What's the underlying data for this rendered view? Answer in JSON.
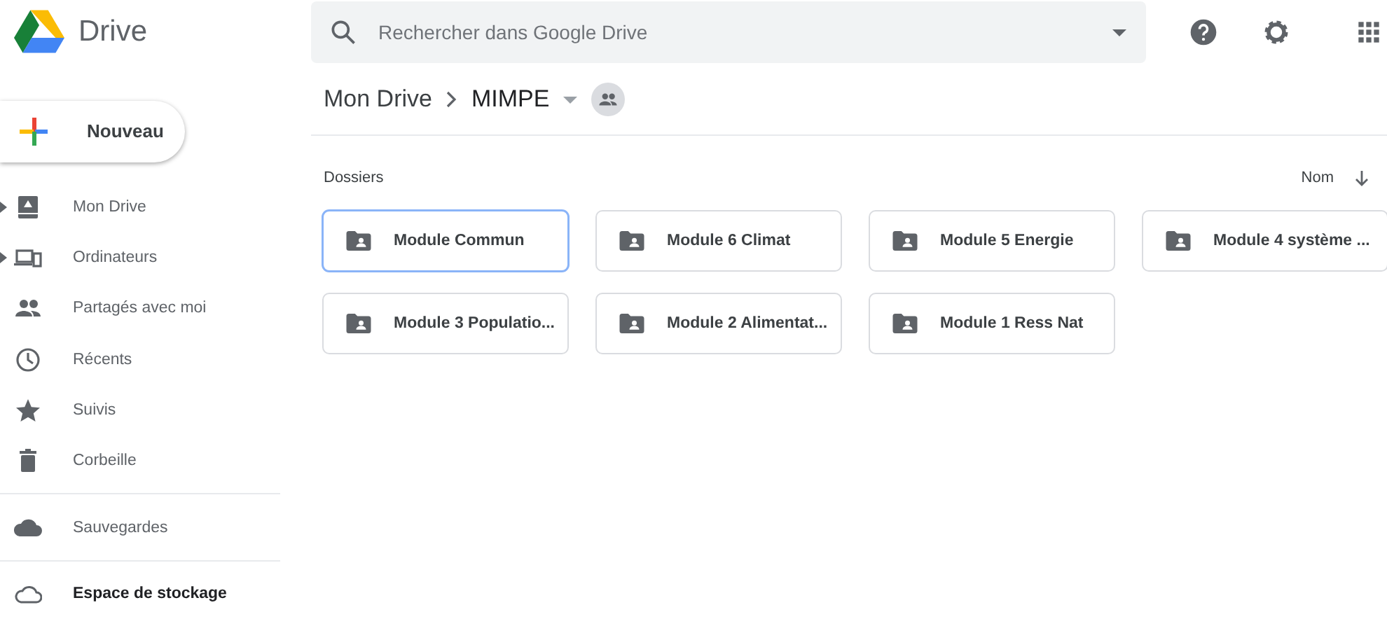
{
  "app": {
    "name": "Drive"
  },
  "new_button": {
    "label": "Nouveau"
  },
  "sidebar": {
    "items": [
      {
        "label": "Mon Drive",
        "expandable": true
      },
      {
        "label": "Ordinateurs",
        "expandable": true
      },
      {
        "label": "Partagés avec moi",
        "expandable": false
      },
      {
        "label": "Récents",
        "expandable": false
      },
      {
        "label": "Suivis",
        "expandable": false
      },
      {
        "label": "Corbeille",
        "expandable": false
      }
    ],
    "backups": {
      "label": "Sauvegardes"
    },
    "storage": {
      "label": "Espace de stockage"
    }
  },
  "search": {
    "placeholder": "Rechercher dans Google Drive"
  },
  "breadcrumb": [
    {
      "label": "Mon Drive"
    },
    {
      "label": "MIMPE"
    }
  ],
  "section": {
    "title": "Dossiers",
    "sort_label": "Nom"
  },
  "folders": [
    {
      "name": "Module Commun",
      "selected": true
    },
    {
      "name": "Module 6 Climat",
      "selected": false
    },
    {
      "name": "Module 5 Energie",
      "selected": false
    },
    {
      "name": "Module 4 système ...",
      "selected": false
    },
    {
      "name": "Module 3 Populatio...",
      "selected": false
    },
    {
      "name": "Module 2 Alimentat...",
      "selected": false
    },
    {
      "name": "Module 1 Ress Nat",
      "selected": false
    }
  ]
}
